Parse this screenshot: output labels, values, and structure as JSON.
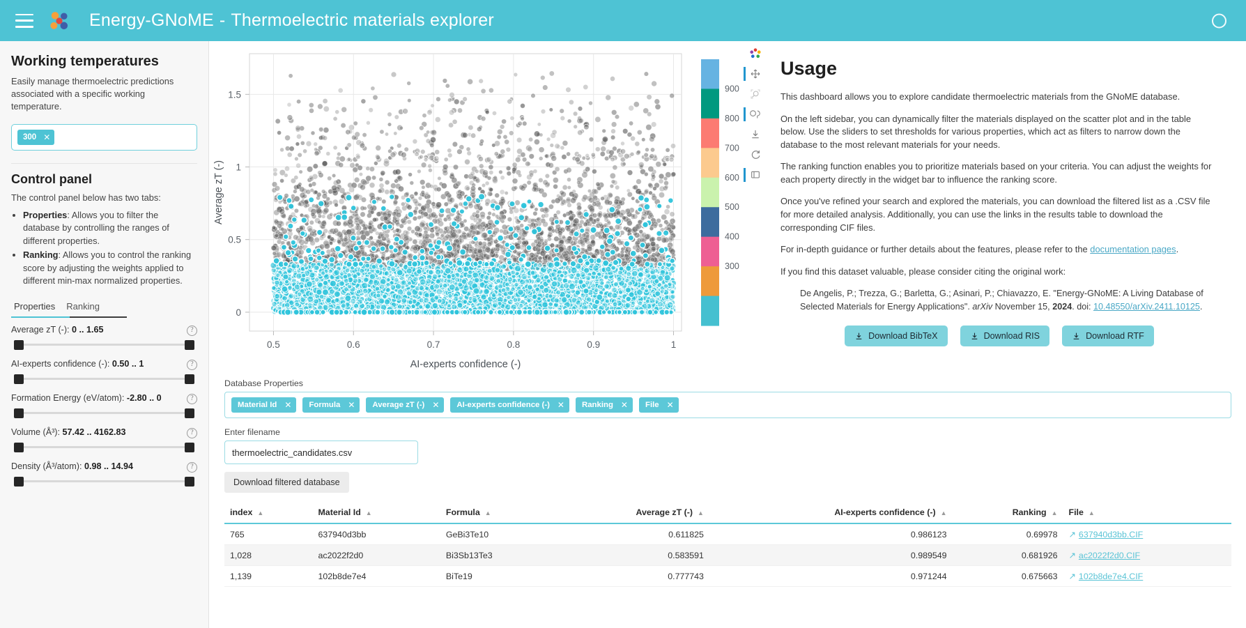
{
  "header": {
    "title_main": "Energy-GNoME",
    "dash": "-",
    "title_sub": "Thermoelectric materials explorer",
    "menu_icon": "hamburger-icon",
    "logo_icon": "molecule-logo-icon",
    "status_icon": "loading-spinner-icon"
  },
  "sidebar": {
    "heading": "Working temperatures",
    "description": "Easily manage thermoelectric predictions associated with a specific working temperature.",
    "temperature_tags": [
      "300"
    ],
    "control_heading": "Control panel",
    "control_intro": "The control panel below has two tabs:",
    "bullets": [
      {
        "term": "Properties",
        "text": ": Allows you to filter the database by controlling the ranges of different properties."
      },
      {
        "term": "Ranking",
        "text": ": Allows you to control the ranking score by adjusting the weights applied to different min-max normalized properties."
      }
    ],
    "tabs": [
      {
        "label": "Properties",
        "active": true
      },
      {
        "label": "Ranking",
        "active": false
      }
    ],
    "sliders": [
      {
        "name": "Average zT (-)",
        "label_prefix": "Average zT (-): ",
        "range": "0 .. 1.65"
      },
      {
        "name": "AI-experts confidence (-)",
        "label_prefix": "AI-experts confidence (-): ",
        "range": "0.50 .. 1"
      },
      {
        "name": "Formation Energy (eV/atom)",
        "label_prefix": "Formation Energy (eV/atom): ",
        "range": "-2.80 .. 0"
      },
      {
        "name": "Volume (Å³)",
        "label_prefix": "Volume (Å³): ",
        "range": "57.42 .. 4162.83"
      },
      {
        "name": "Density (Å³/atom)",
        "label_prefix": "Density (Å³/atom): ",
        "range": "0.98 .. 14.94"
      }
    ]
  },
  "chart_data": {
    "type": "scatter",
    "title": "",
    "xlabel": "AI-experts confidence (-)",
    "ylabel": "Average zT (-)",
    "xlim": [
      0.47,
      1.01
    ],
    "ylim": [
      -0.13,
      1.78
    ],
    "xticks": [
      "0.5",
      "0.6",
      "0.7",
      "0.8",
      "0.9",
      "1"
    ],
    "xtick_values": [
      0.5,
      0.6,
      0.7,
      0.8,
      0.9,
      1.0
    ],
    "yticks": [
      "0",
      "0.5",
      "1",
      "1.5"
    ],
    "ytick_values": [
      0,
      0.5,
      1,
      1.5
    ],
    "grid": true,
    "legend_position": "right",
    "colorbar": {
      "title": "",
      "ticks": [
        "900",
        "800",
        "700",
        "600",
        "500",
        "400",
        "300"
      ],
      "tick_values": [
        900,
        800,
        700,
        600,
        500,
        400,
        300
      ],
      "colors": [
        "#66b3e2",
        "#00997f",
        "#fc7b72",
        "#fcca8e",
        "#caf2ad",
        "#3d6c9e",
        "#ee5f93",
        "#ee9a3a",
        "#45c0d0"
      ]
    },
    "series": [
      {
        "name": "background",
        "color": "#5a5a5a",
        "opacity": 0.45,
        "count": 14000
      },
      {
        "name": "highlight",
        "color": "#29c2d9",
        "opacity": 0.9,
        "count": 5200
      }
    ]
  },
  "usage": {
    "heading": "Usage",
    "paragraphs": [
      "This dashboard allows you to explore candidate thermoelectric materials from the GNoME database.",
      "On the left sidebar, you can dynamically filter the materials displayed on the scatter plot and in the table below. Use the sliders to set thresholds for various properties, which act as filters to narrow down the database to the most relevant materials for your needs.",
      "The ranking function enables you to prioritize materials based on your criteria. You can adjust the weights for each property directly in the widget bar to influence the ranking score.",
      "Once you've refined your search and explored the materials, you can download the filtered list as a .CSV file for more detailed analysis. Additionally, you can use the links in the results table to download the corresponding CIF files."
    ],
    "doc_line_before": "For in-depth guidance or further details about the features, please refer to the ",
    "doc_link": "documentation pages",
    "doc_line_after": ".",
    "cite_intro": "If you find this dataset valuable, please consider citing the original work:",
    "citation_text": "De Angelis, P.; Trezza, G.; Barletta, G.; Asinari, P.; Chiavazzo, E. \"Energy-GNoME: A Living Database of Selected Materials for Energy Applications\". ",
    "citation_journal": "arXiv",
    "citation_date": " November 15, ",
    "citation_year": "2024",
    "citation_doi_label": ". doi: ",
    "citation_doi": "10.48550/arXiv.2411.10125",
    "citation_end": ".",
    "download_buttons": [
      {
        "label": "Download BibTeX",
        "icon": "download-icon"
      },
      {
        "label": "Download RIS",
        "icon": "download-icon"
      },
      {
        "label": "Download RTF",
        "icon": "download-icon"
      }
    ]
  },
  "modebar": {
    "buttons": [
      "plotly-logo-icon",
      "pan-icon",
      "zoom-select-icon",
      "lasso-select-icon",
      "download-camera-icon",
      "reset-axes-icon",
      "toggle-spikes-icon"
    ]
  },
  "database": {
    "properties_label": "Database Properties",
    "property_chips": [
      "Material Id",
      "Formula",
      "Average zT (-)",
      "AI-experts confidence (-)",
      "Ranking",
      "File"
    ],
    "filename_label": "Enter filename",
    "filename_value": "thermoelectric_candidates.csv",
    "filename_placeholder": "Enter filename",
    "download_db_label": "Download filtered database"
  },
  "table": {
    "columns": [
      {
        "label": "index",
        "align": "left"
      },
      {
        "label": "Material Id",
        "align": "left"
      },
      {
        "label": "Formula",
        "align": "left"
      },
      {
        "label": "Average zT (-)",
        "align": "right"
      },
      {
        "label": "AI-experts confidence (-)",
        "align": "right"
      },
      {
        "label": "Ranking",
        "align": "right"
      },
      {
        "label": "File",
        "align": "left"
      }
    ],
    "rows": [
      {
        "index": "765",
        "material_id": "637940d3bb",
        "formula": "GeBi3Te10",
        "avg_zt": "0.611825",
        "confidence": "0.986123",
        "ranking": "0.69978",
        "file": "637940d3bb.CIF"
      },
      {
        "index": "1,028",
        "material_id": "ac2022f2d0",
        "formula": "Bi3Sb13Te3",
        "avg_zt": "0.583591",
        "confidence": "0.989549",
        "ranking": "0.681926",
        "file": "ac2022f2d0.CIF"
      },
      {
        "index": "1,139",
        "material_id": "102b8de7e4",
        "formula": "BiTe19",
        "avg_zt": "0.777743",
        "confidence": "0.971244",
        "ranking": "0.675663",
        "file": "102b8de7e4.CIF"
      }
    ]
  },
  "colors": {
    "accent": "#4ec3d4",
    "chip": "#5cc8d8",
    "link": "#5bc4d6",
    "highlight_points": "#29c2d9"
  }
}
